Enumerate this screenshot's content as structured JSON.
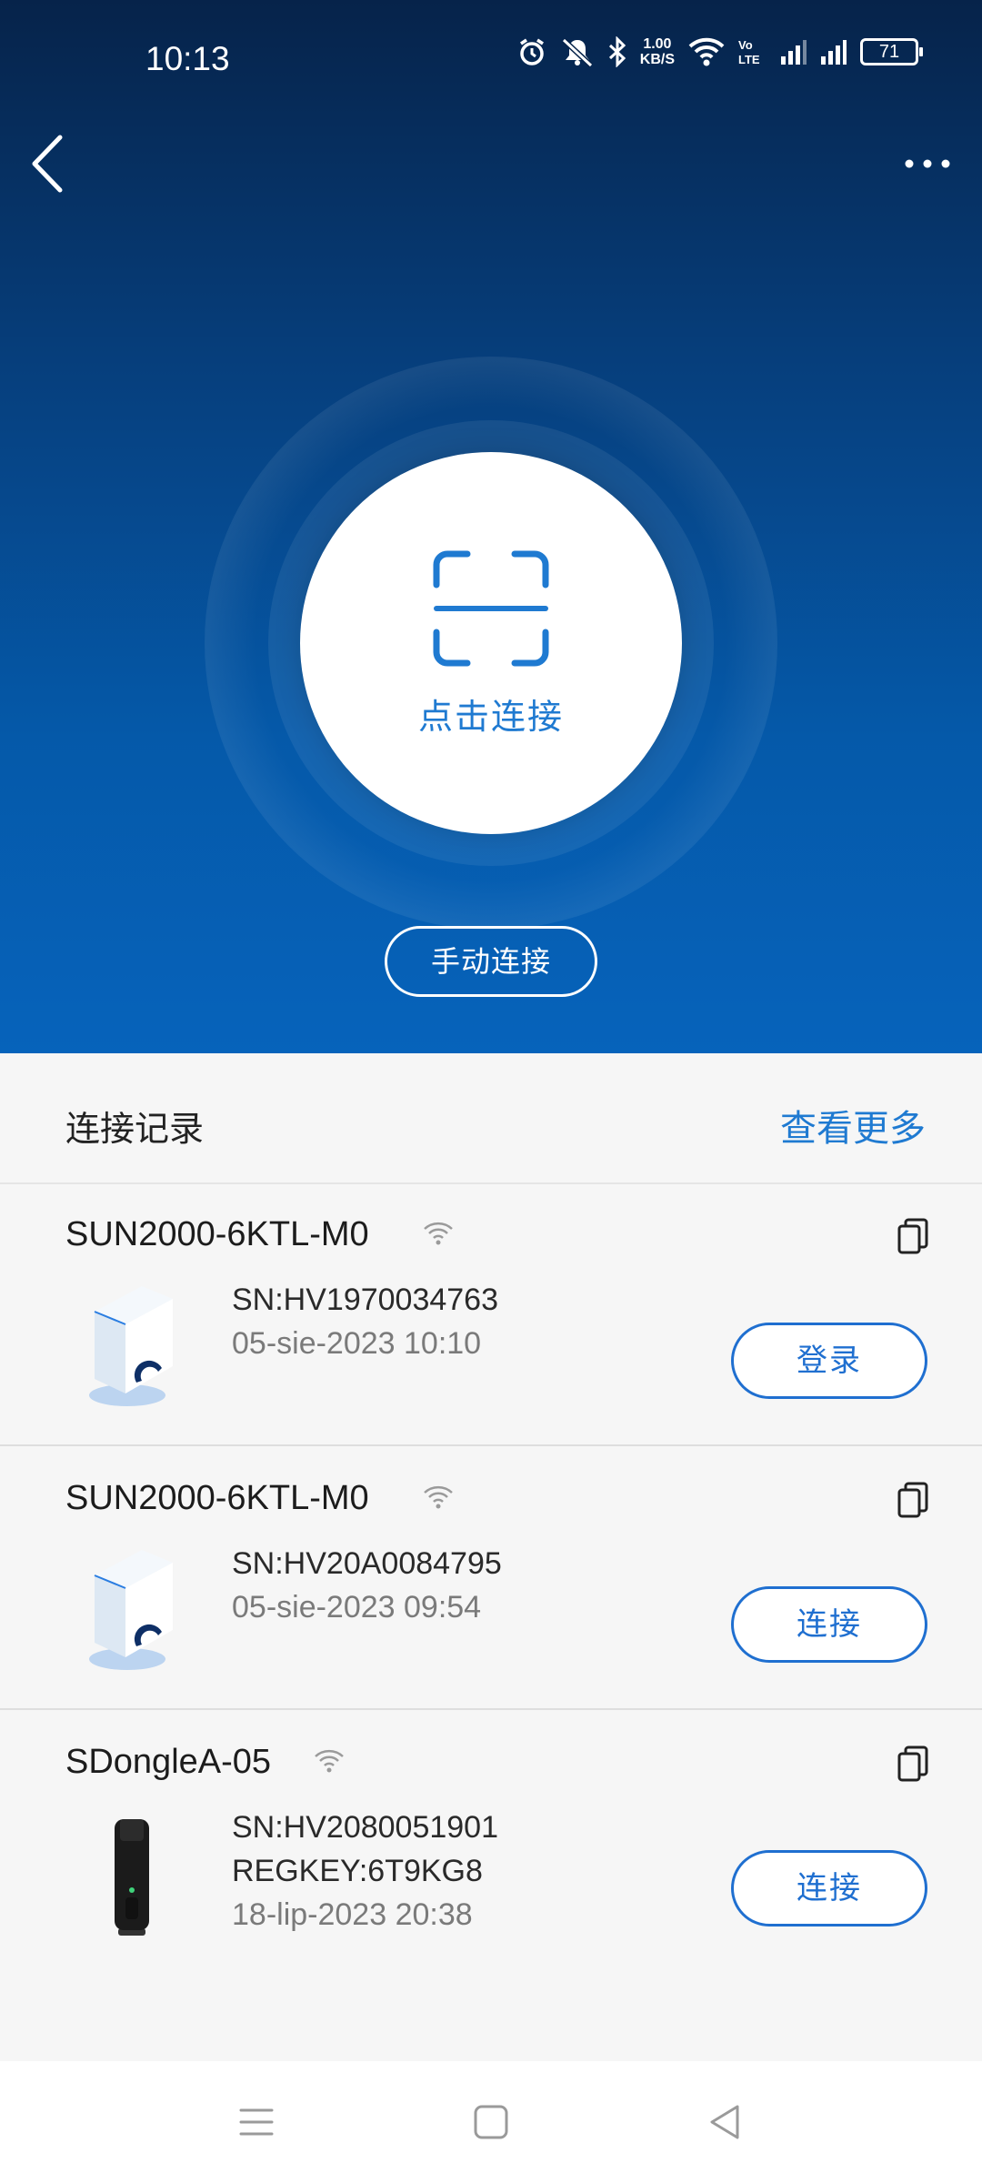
{
  "status_bar": {
    "time": "10:13",
    "net_speed_value": "1.00",
    "net_speed_unit": "KB/S",
    "battery": "71"
  },
  "hero": {
    "scan_label": "点击连接",
    "manual_connect": "手动连接"
  },
  "records": {
    "title": "连接记录",
    "see_more": "查看更多",
    "devices": [
      {
        "name": "SUN2000-6KTL-M0",
        "sn": "SN:HV1970034763",
        "date": "05-sie-2023 10:10",
        "action": "登录",
        "type": "inverter"
      },
      {
        "name": "SUN2000-6KTL-M0",
        "sn": "SN:HV20A0084795",
        "date": "05-sie-2023 09:54",
        "action": "连接",
        "type": "inverter"
      },
      {
        "name": "SDongleA-05",
        "sn": "SN:HV2080051901",
        "regkey": "REGKEY:6T9KG8",
        "date": "18-lip-2023 20:38",
        "action": "连接",
        "type": "dongle"
      }
    ]
  },
  "colors": {
    "accent": "#1f7ad1",
    "hero_top": "#06234a",
    "hero_bottom": "#0663bb"
  }
}
